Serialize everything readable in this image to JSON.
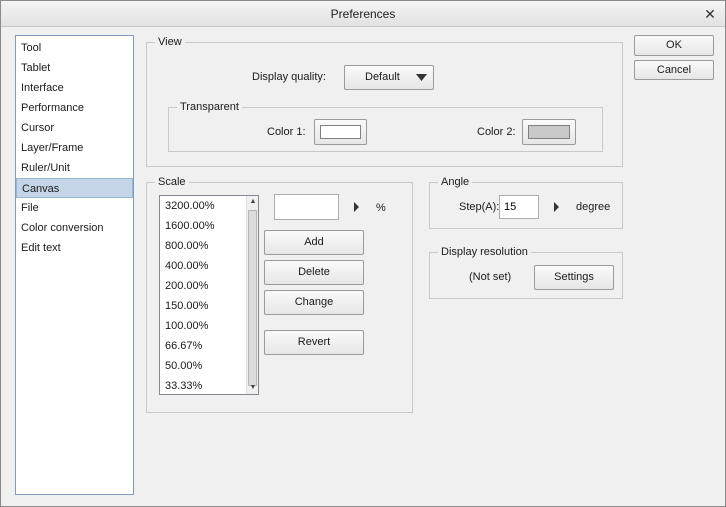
{
  "window": {
    "title": "Preferences",
    "close_glyph": "✕"
  },
  "sidebar": {
    "items": [
      {
        "label": "Tool"
      },
      {
        "label": "Tablet"
      },
      {
        "label": "Interface"
      },
      {
        "label": "Performance"
      },
      {
        "label": "Cursor"
      },
      {
        "label": "Layer/Frame"
      },
      {
        "label": "Ruler/Unit"
      },
      {
        "label": "Canvas",
        "selected": true
      },
      {
        "label": "File"
      },
      {
        "label": "Color conversion"
      },
      {
        "label": "Edit text"
      }
    ]
  },
  "buttons": {
    "ok": "OK",
    "cancel": "Cancel"
  },
  "view": {
    "title": "View",
    "display_quality_label": "Display quality:",
    "display_quality_value": "Default",
    "transparent": {
      "title": "Transparent",
      "color1_label": "Color 1:",
      "color1_value": "#ffffff",
      "color2_label": "Color 2:",
      "color2_value": "#c8c8c8"
    }
  },
  "scale": {
    "title": "Scale",
    "items": [
      "3200.00%",
      "1600.00%",
      "800.00%",
      "400.00%",
      "200.00%",
      "150.00%",
      "100.00%",
      "66.67%",
      "50.00%",
      "33.33%"
    ],
    "input_value": "",
    "unit": "%",
    "add_label": "Add",
    "delete_label": "Delete",
    "change_label": "Change",
    "revert_label": "Revert"
  },
  "angle": {
    "title": "Angle",
    "step_label": "Step(A):",
    "step_value": "15",
    "unit": "degree"
  },
  "display_resolution": {
    "title": "Display resolution",
    "status": "(Not set)",
    "settings_label": "Settings"
  },
  "colors": {
    "selection": "#c5d5e8",
    "list_border": "#7f9db9"
  },
  "icons": {
    "close": "close-icon",
    "dropdown": "chevron-down-icon",
    "spin": "triangle-right-icon"
  }
}
